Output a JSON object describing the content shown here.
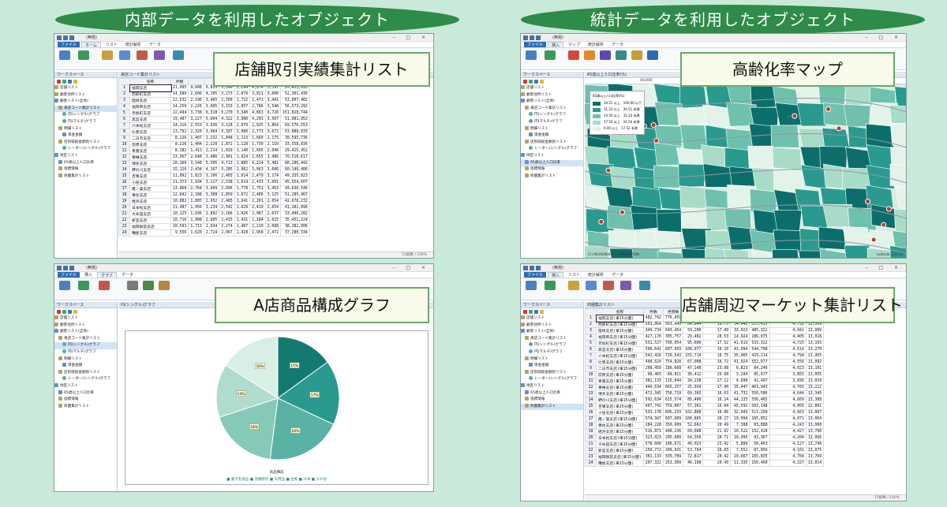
{
  "banners": {
    "left": "内部データを利用したオブジェクト",
    "right": "統計データを利用したオブジェクト"
  },
  "callouts": {
    "top_left": "店舗取引実績集計リスト",
    "top_right": "高齢化率マップ",
    "bottom_left": "A店商品構成グラフ",
    "bottom_right": "店舗周辺マーケット集計リスト"
  },
  "window": {
    "title": "(無題)",
    "controls": "– □ ×",
    "tabs_file": "ファイル",
    "tabs_home": "ホーム",
    "tabs_list": "リスト",
    "tabs_stat": "統計解析",
    "tabs_data": "データ",
    "tabs_insert": "挿入",
    "tabs_graph": "グラフ",
    "tabs_map": "マップ"
  },
  "workspace": {
    "header": "ワークスペース",
    "tree_left": [
      "店舗リスト",
      "顧客住所リスト",
      "顧客リスト(全体)",
      "来店コード集計リスト",
      "円(シングル)グラフ",
      "円(マルチ)グラフ",
      "明細リスト",
      "単金金額",
      "店別取扱金額別リスト",
      "レーダー(シングル)グラフ",
      "地区リスト",
      "65歳以上人口比率",
      "指標情報",
      "商圏集計リスト"
    ],
    "tree_right": [
      "店舗リスト",
      "顧客住所リスト",
      "顧客リスト(全体)",
      "来店コード集計リスト",
      "円(シングル)グラフ",
      "円(マルチ)グラフ",
      "明細リスト",
      "単金金額",
      "店別取扱金額別リスト",
      "レーダー(シングル)グラフ",
      "地区リスト",
      "65歳以上人口比率",
      "指標情報",
      "商圏集計リスト"
    ]
  },
  "list1": {
    "header": "来店コード集計リスト",
    "col_name": "名称",
    "col_count": "件数",
    "rows": [
      [
        "1",
        "福岡支店",
        "21,995",
        "4,608",
        "6,815",
        "5,146",
        "2,294",
        "4,874",
        "5,597",
        "95,455,695"
      ],
      [
        "2",
        "西新町支店",
        "14,586",
        "2,606",
        "4,105",
        "3,273",
        "2,079",
        "3,021",
        "3,600",
        "52,301,436"
      ],
      [
        "3",
        "陸崎支店",
        "12,531",
        "2,196",
        "3,465",
        "2,760",
        "1,722",
        "2,472",
        "3,441",
        "53,007,482"
      ],
      [
        "4",
        "福岡県支店",
        "14,256",
        "2,226",
        "3,905",
        "3,153",
        "2,057",
        "2,786",
        "3,546",
        "56,573,292"
      ],
      [
        "5",
        "赤坂町支店",
        "22,494",
        "3,738",
        "6,318",
        "5,270",
        "3,340",
        "4,863",
        "6,726",
        "151,028,744"
      ],
      [
        "6",
        "高宮支店",
        "19,487",
        "3,227",
        "5,604",
        "4,322",
        "3,080",
        "4,293",
        "3,507",
        "51,081,852"
      ],
      [
        "7",
        "六本松支店",
        "14,116",
        "2,553",
        "3,936",
        "3,128",
        "2,079",
        "2,925",
        "3,864",
        "69,576,553"
      ],
      [
        "8",
        "比恵支店",
        "13,791",
        "2,326",
        "3,904",
        "3,187",
        "2,080",
        "2,773",
        "3,672",
        "53,888,833"
      ],
      [
        "9",
        "二日市支店",
        "8,226",
        "1,407",
        "2,232",
        "1,848",
        "1,113",
        "1,660",
        "2,175",
        "30,595,736"
      ],
      [
        "10",
        "前原支店",
        "8,226",
        "1,404",
        "2,220",
        "1,872",
        "1,128",
        "1,730",
        "2,110",
        "33,558,836"
      ],
      [
        "11",
        "青葉支店",
        "8,182",
        "1,413",
        "2,214",
        "1,819",
        "1,140",
        "1,695",
        "2,046",
        "29,415,452"
      ],
      [
        "12",
        "香椎支店",
        "13,567",
        "2,648",
        "3,486",
        "2,901",
        "1,924",
        "2,655",
        "3,486",
        "70,510,617"
      ],
      [
        "13",
        "博多支店",
        "20,166",
        "3,548",
        "5,505",
        "4,713",
        "2,885",
        "4,224",
        "5,481",
        "80,286,442"
      ],
      [
        "14",
        "野の川支店",
        "15,126",
        "2,434",
        "4,167",
        "3,285",
        "2,062",
        "3,063",
        "3,606",
        "60,149,406"
      ],
      [
        "15",
        "吉塚支店",
        "11,092",
        "1,823",
        "3,106",
        "2,403",
        "1,614",
        "2,479",
        "3,174",
        "49,335,823"
      ],
      [
        "16",
        "小笹支店",
        "11,373",
        "1,934",
        "3,117",
        "2,538",
        "1,614",
        "2,433",
        "3,681",
        "45,554,607"
      ],
      [
        "17",
        "雁ノ巣支店",
        "13,868",
        "2,764",
        "3,609",
        "2,996",
        "1,778",
        "2,751",
        "3,453",
        "49,636,546"
      ],
      [
        "18",
        "香住支店",
        "12,642",
        "2,188",
        "3,308",
        "2,859",
        "1,672",
        "2,486",
        "3,125",
        "51,285,467"
      ],
      [
        "19",
        "姪浜支店",
        "10,882",
        "1,805",
        "2,952",
        "2,485",
        "1,641",
        "2,201",
        "2,654",
        "42,676,232"
      ],
      [
        "20",
        "日本松支店",
        "11,487",
        "1,956",
        "3,234",
        "2,542",
        "1,629",
        "2,419",
        "2,654",
        "41,181,896"
      ],
      [
        "21",
        "大牟田支店",
        "10,125",
        "1,696",
        "2,892",
        "2,166",
        "1,426",
        "2,087",
        "2,637",
        "33,496,282"
      ],
      [
        "22",
        "新宮支店",
        "10,716",
        "1,908",
        "2,905",
        "2,415",
        "1,431",
        "2,184",
        "2,625",
        "35,451,224"
      ],
      [
        "23",
        "福岡駅前支店",
        "10,591",
        "1,713",
        "2,934",
        "2,274",
        "1,407",
        "2,210",
        "2,688",
        "38,382,006"
      ],
      [
        "24",
        "糟屋支店",
        "9,556",
        "1,620",
        "2,724",
        "2,067",
        "1,418",
        "1,958",
        "2,472",
        "37,280,534"
      ]
    ],
    "status": "15総数 / 100%"
  },
  "map_panel": {
    "header": "65歳以上人口比率(%)",
    "zoom": "40,000",
    "legend_title": "65歳以上人口比率(%)",
    "legend": [
      [
        "34.51 以上",
        "100.00 以下"
      ],
      [
        "31.23 以上",
        "34.51 未満"
      ],
      [
        "24.50 以上",
        "31.23 未満"
      ],
      [
        "17.52 以上",
        "24.50 未満"
      ],
      [
        "0.00 以上",
        "17.52 未満"
      ]
    ],
    "legend_colors": [
      "#0c6e6a",
      "#2a9a8e",
      "#6fc1ae",
      "#a9dcc8",
      "#e3f3ea"
    ],
    "credit": "(C) INCREMENT P CORPORATION",
    "scale": "Latitude: 135.34"
  },
  "graph_panel": {
    "header": "円(シングル)グラフ",
    "legend": "■ 菓子乳製品 ■ 酒類飲料 ■ 日用品 ■ 生鮮 ■ 冷凍 ■ その他",
    "title": "商品構成"
  },
  "chart_data": {
    "type": "pie",
    "values": [
      15,
      17,
      20,
      18,
      14,
      16
    ],
    "labels": [
      "15%",
      "17%",
      "20%",
      "18%",
      "14%",
      "16%"
    ],
    "colors": [
      "#137a72",
      "#2a9a8e",
      "#5ab2a4",
      "#86c9b8",
      "#b1dccd",
      "#d8efe5"
    ]
  },
  "list4": {
    "header": "商圏集計リスト",
    "col_name": "名称",
    "groups": [
      "件数",
      "世帯数",
      "65歳以上比率",
      "従業者数",
      "1人当り小売販売額"
    ],
    "rows": [
      [
        "1",
        "福岡支店(車15分圏)",
        "482,742",
        "776,459",
        "21,604",
        "16.48",
        "45,021",
        "575,581",
        "4,609",
        "13,086"
      ],
      [
        "2",
        "西新町支店(車15分圏)",
        "503,864",
        "563,449",
        "64,844",
        "19.73",
        "34,442",
        "375,415",
        "4,752",
        "13,009"
      ],
      [
        "3",
        "陸崎支店(車15分圏)",
        "349,734",
        "643,454",
        "59,200",
        "17.49",
        "33,023",
        "485,322",
        "4,441",
        "13,009"
      ],
      [
        "4",
        "福岡県支店(車15分圏)",
        "427,176",
        "305,757",
        "29,482",
        "20.53",
        "14,924",
        "186,075",
        "4,405",
        "13,018"
      ],
      [
        "5",
        "赤坂町支店(車15分圏)",
        "531,527",
        "760,054",
        "95,600",
        "17.52",
        "41,613",
        "533,322",
        "4,725",
        "13,193"
      ],
      [
        "6",
        "高宮支店(車15分圏)",
        "596,641",
        "687,959",
        "100,977",
        "16.10",
        "43,094",
        "544,708",
        "4,614",
        "13,270"
      ],
      [
        "7",
        "六本松支店(車15分圏)",
        "542,426",
        "726,543",
        "155,714",
        "16.75",
        "35,965",
        "429,214",
        "4,794",
        "13,455"
      ],
      [
        "8",
        "比恵支店(車15分圏)",
        "490,624",
        "754,820",
        "67,008",
        "16.72",
        "41,024",
        "552,677",
        "4,556",
        "13,092"
      ],
      [
        "9",
        "二日市支店(車15分圏)",
        "298,450",
        "186,668",
        "47,148",
        "23.08",
        "6,823",
        "84,246",
        "4,023",
        "13,101"
      ],
      [
        "10",
        "前原支店(車15分圏)",
        "90,465",
        "89,811",
        "30,412",
        "25.68",
        "3,284",
        "85,677",
        "3,855",
        "13,055"
      ],
      [
        "11",
        "青葉支店(車15分圏)",
        "381,133",
        "115,844",
        "34,238",
        "27.12",
        "4,600",
        "42,497",
        "3,836",
        "13,019"
      ],
      [
        "12",
        "香椎支店(車15分圏)",
        "440,634",
        "665,257",
        "25,934",
        "17.40",
        "35,447",
        "463,943",
        "4,765",
        "13,222"
      ],
      [
        "13",
        "博多支店(車15分圏)",
        "472,345",
        "756,719",
        "69,303",
        "16.63",
        "41,732",
        "550,586",
        "4,644",
        "13,345"
      ],
      [
        "14",
        "野の川支店(車15分圏)",
        "592,634",
        "615,574",
        "85,400",
        "16.24",
        "44,133",
        "556,465",
        "4,669",
        "13,308"
      ],
      [
        "15",
        "吉塚支店(車15分圏)",
        "497,742",
        "759,007",
        "57,301",
        "16.04",
        "45,592",
        "583,148",
        "4,456",
        "12,891"
      ],
      [
        "16",
        "小笹支店(車15分圏)",
        "533,178",
        "605,233",
        "102,868",
        "16.06",
        "32,943",
        "513,258",
        "4,663",
        "13,007"
      ],
      [
        "17",
        "雁ノ巣支店(車15分圏)",
        "574,347",
        "607,609",
        "100,865",
        "20.27",
        "10,094",
        "165,852",
        "4,071",
        "13,064"
      ],
      [
        "18",
        "香住支店(車15分圏)",
        "284,228",
        "350,609",
        "52,662",
        "20.49",
        "7,388",
        "83,888",
        "4,243",
        "13,068"
      ],
      [
        "19",
        "姪浜支店(車15分圏)",
        "516,871",
        "448,236",
        "69,688",
        "21.02",
        "10,522",
        "152,428",
        "4,427",
        "13,790"
      ],
      [
        "20",
        "日本松支店(車15分圏)",
        "323,023",
        "295,689",
        "64,350",
        "20.71",
        "10,095",
        "93,367",
        "4,204",
        "13,066"
      ],
      [
        "21",
        "大牟田支店(車15分圏)",
        "578,600",
        "186,671",
        "40,023",
        "23.42",
        "5,884",
        "50,463",
        "4,127",
        "13,748"
      ],
      [
        "22",
        "新宮支店(車15分圏)",
        "250,772",
        "209,931",
        "53,794",
        "20.03",
        "7,552",
        "87,856",
        "4,161",
        "13,075"
      ],
      [
        "23",
        "福岡駅前支店(車15分圏)",
        "301,133",
        "335,709",
        "72,817",
        "20.42",
        "10,667",
        "165,835",
        "4,704",
        "13,769"
      ],
      [
        "24",
        "糟屋支店(車15分圏)",
        "297,322",
        "253,309",
        "46,198",
        "20.49",
        "11,335",
        "150,460",
        "4,227",
        "13,014"
      ]
    ],
    "status": "15総数 / 100%"
  }
}
